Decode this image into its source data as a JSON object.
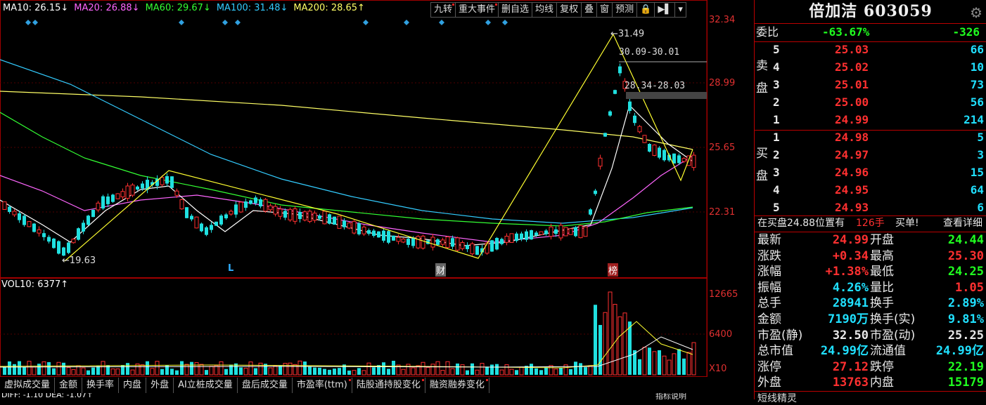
{
  "ma_legend": [
    {
      "label": "MA10: 26.15↓",
      "color": "#ffffff"
    },
    {
      "label": "MA20: 26.88↓",
      "color": "#ff66ff"
    },
    {
      "label": "MA60: 29.67↓",
      "color": "#33ff33"
    },
    {
      "label": "MA100: 31.48↓",
      "color": "#33ccff"
    },
    {
      "label": "MA200: 28.65↑",
      "color": "#ffff66"
    }
  ],
  "toolbar": [
    "九转",
    "重大事件",
    "删自选",
    "均线",
    "复权",
    "叠",
    "窗",
    "预测",
    "🔒",
    "▶▌",
    "▾"
  ],
  "toolbar_dots": [
    0,
    1
  ],
  "price_axis": [
    "32.34",
    "28.99",
    "25.65",
    "22.31"
  ],
  "vol_axis": [
    "12665",
    "6400",
    "X10"
  ],
  "chart_marks": {
    "high": "←31.49",
    "low": "←19.63",
    "range1": "30.09-30.01",
    "range2": "28.34-28.03",
    "marker_L": "L",
    "marker_cai": "财",
    "marker_bang": "榜"
  },
  "vol_label": "VOL10: 6377↑",
  "bottom_tabs": [
    "虚拟成交量",
    "金额",
    "换手率",
    "内盘",
    "外盘",
    "AI立桩成交量",
    "盘后成交量",
    "市盈率(ttm)",
    "陆股通持股变化",
    "融资融券变化"
  ],
  "bottom_tab_dots": [
    7,
    8,
    9
  ],
  "bottom_strip": {
    "left": "DIFF: -1.10  DEA: -1.07↑",
    "mid": "指标说明"
  },
  "stock": {
    "name": "倍加洁",
    "code": "603059"
  },
  "weibi": {
    "label": "委比",
    "pct": "-63.67%",
    "diff": "-326"
  },
  "sell_label": "卖盘",
  "buy_label": "买盘",
  "sell": [
    {
      "n": "5",
      "p": "25.03",
      "v": "66"
    },
    {
      "n": "4",
      "p": "25.02",
      "v": "10"
    },
    {
      "n": "3",
      "p": "25.01",
      "v": "73"
    },
    {
      "n": "2",
      "p": "25.00",
      "v": "56"
    },
    {
      "n": "1",
      "p": "24.99",
      "v": "214"
    }
  ],
  "buy": [
    {
      "n": "1",
      "p": "24.98",
      "v": "5"
    },
    {
      "n": "2",
      "p": "24.97",
      "v": "3"
    },
    {
      "n": "3",
      "p": "24.96",
      "v": "15"
    },
    {
      "n": "4",
      "p": "24.95",
      "v": "64"
    },
    {
      "n": "5",
      "p": "24.93",
      "v": "6"
    }
  ],
  "notice": {
    "a": "在买盘24.88位置有",
    "b": "126手",
    "c": "买单!",
    "d": "查看详细"
  },
  "quote": [
    {
      "l1": "最新",
      "v1": "24.99",
      "c1": "r",
      "l2": "开盘",
      "v2": "24.44",
      "c2": "g"
    },
    {
      "l1": "涨跌",
      "v1": "+0.34",
      "c1": "r",
      "l2": "最高",
      "v2": "25.30",
      "c2": "r"
    },
    {
      "l1": "涨幅",
      "v1": "+1.38%",
      "c1": "r",
      "l2": "最低",
      "v2": "24.25",
      "c2": "g"
    },
    {
      "l1": "振幅",
      "v1": "4.26%",
      "c1": "c",
      "l2": "量比",
      "v2": "1.05",
      "c2": "r"
    },
    {
      "l1": "总手",
      "v1": "28941",
      "c1": "c",
      "l2": "换手",
      "v2": "2.89%",
      "c2": "c"
    },
    {
      "l1": "金额",
      "v1": "7190万",
      "c1": "c",
      "l2": "换手(实)",
      "v2": "9.81%",
      "c2": "c"
    },
    {
      "l1": "市盈(静)",
      "v1": "32.50",
      "c1": "w",
      "l2": "市盈(动)",
      "v2": "25.25",
      "c2": "w"
    },
    {
      "l1": "总市值",
      "v1": "24.99亿",
      "c1": "c",
      "l2": "流通值",
      "v2": "24.99亿",
      "c2": "c"
    },
    {
      "l1": "涨停",
      "v1": "27.12",
      "c1": "r",
      "l2": "跌停",
      "v2": "22.19",
      "c2": "g"
    },
    {
      "l1": "外盘",
      "v1": "13763",
      "c1": "r",
      "l2": "内盘",
      "v2": "15179",
      "c2": "g"
    }
  ],
  "footer_label": "短线精灵"
}
